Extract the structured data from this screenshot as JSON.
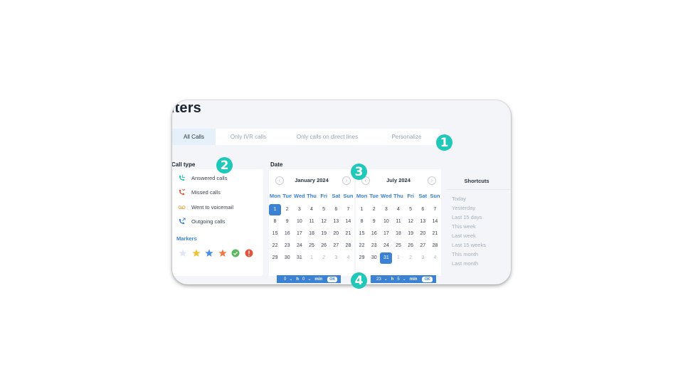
{
  "header": {
    "title": "ilters"
  },
  "tabs": [
    {
      "label": "All Calls",
      "active": true
    },
    {
      "label": "Only IVR calls",
      "active": false
    },
    {
      "label": "Only calls on direct lines",
      "active": false
    },
    {
      "label": "Personalize",
      "active": false
    }
  ],
  "call_type": {
    "label": "Call type",
    "items": [
      {
        "label": "Answered calls",
        "icon": "answered-call-icon",
        "color": "#1fc8b8"
      },
      {
        "label": "Missed calls",
        "icon": "missed-call-icon",
        "color": "#e5533d"
      },
      {
        "label": "Went to voicemail",
        "icon": "voicemail-icon",
        "color": "#e8a33d"
      },
      {
        "label": "Outgoing calls",
        "icon": "outgoing-call-icon",
        "color": "#3b82d4"
      }
    ],
    "markers_label": "Markers",
    "markers": [
      {
        "icon": "star-icon",
        "color": "#dfe7f5"
      },
      {
        "icon": "star-icon",
        "color": "#f2c12e"
      },
      {
        "icon": "star-icon",
        "color": "#4a90e2"
      },
      {
        "icon": "star-icon",
        "color": "#ee7a45"
      },
      {
        "icon": "check-circle-icon",
        "color": "#5cb85c"
      },
      {
        "icon": "exclamation-circle-icon",
        "color": "#e5533d"
      }
    ]
  },
  "date": {
    "label": "Date",
    "weekdays": [
      "Mon",
      "Tue",
      "Wed",
      "Thu",
      "Fri",
      "Sat",
      "Sun"
    ],
    "calendars": [
      {
        "month": "January 2024",
        "selected": "1",
        "weeks": [
          [
            "1",
            "2",
            "3",
            "4",
            "5",
            "6",
            "7"
          ],
          [
            "8",
            "9",
            "10",
            "11",
            "12",
            "13",
            "14"
          ],
          [
            "15",
            "16",
            "17",
            "18",
            "19",
            "20",
            "21"
          ],
          [
            "22",
            "23",
            "24",
            "25",
            "26",
            "27",
            "28"
          ],
          [
            "29",
            "30",
            "31",
            "1",
            "2",
            "3",
            "4"
          ]
        ],
        "muted_from_row4_index": 3
      },
      {
        "month": "July 2024",
        "selected": "31",
        "weeks": [
          [
            "1",
            "2",
            "3",
            "4",
            "5",
            "6",
            "7"
          ],
          [
            "8",
            "9",
            "10",
            "11",
            "12",
            "13",
            "14"
          ],
          [
            "15",
            "16",
            "17",
            "18",
            "19",
            "20",
            "21"
          ],
          [
            "22",
            "23",
            "24",
            "25",
            "26",
            "27",
            "28"
          ],
          [
            "29",
            "30",
            "31",
            "1",
            "2",
            "3",
            "4"
          ]
        ],
        "muted_from_row4_index": 3
      }
    ],
    "time_start": {
      "hours": "0",
      "minutes": "0",
      "h_label": "h",
      "min_label": "min",
      "ok": "OK"
    },
    "time_end": {
      "hours": "23",
      "minutes": "5",
      "h_label": "h",
      "min_label": "min",
      "ok": "OK"
    }
  },
  "shortcuts": {
    "title": "Shortcuts",
    "items": [
      "Today",
      "Yesterday",
      "Last 15 days",
      "This week",
      "Last week",
      "Last 15 weeks",
      "This month",
      "Last month"
    ]
  },
  "badges": [
    "1",
    "2",
    "3",
    "4"
  ],
  "colors": {
    "accent": "#3b82d4",
    "badge": "#1fc8b8",
    "panel": "#f3f5f9"
  }
}
